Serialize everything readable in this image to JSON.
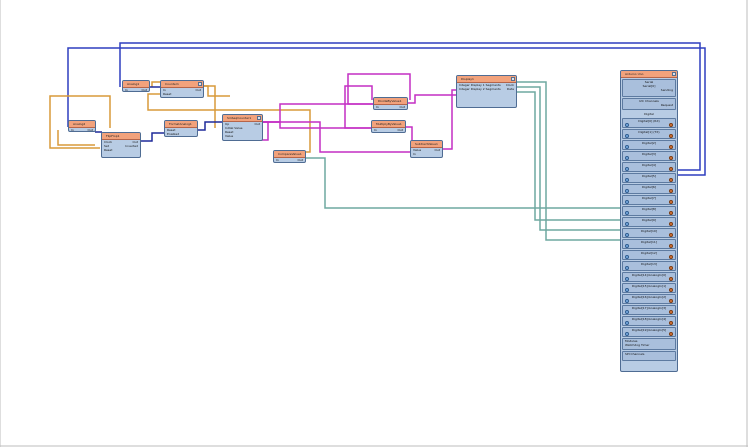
{
  "colors": {
    "node_fill": "#b8cce4",
    "node_header": "#f2a27c",
    "wire_blue": "#2f3fbf",
    "wire_orange": "#d89a3a",
    "wire_magenta": "#c42fc4",
    "wire_teal": "#6fa8a0",
    "wire_navy": "#1f2a9a"
  },
  "nodes": {
    "analog_top": {
      "title": "Analog1",
      "pins": [
        "In",
        "Out"
      ]
    },
    "counter": {
      "title": "Counter1",
      "pins": [
        "In",
        "Reset",
        "Out"
      ]
    },
    "analog_left": {
      "title": "Analog2",
      "pins": [
        "In",
        "Out"
      ]
    },
    "flipflop": {
      "title": "FlipFlop1",
      "pins": [
        "Clock",
        "Set",
        "Reset",
        "Out",
        "Inverted"
      ]
    },
    "smooth": {
      "title": "FormatAnalog1",
      "pins": [
        "Reset",
        "Enabled"
      ]
    },
    "sequence": {
      "title": "SinSeqCounter1",
      "pins": [
        "Up",
        "Initial Value",
        "Reset",
        "Value",
        "Out"
      ]
    },
    "compare": {
      "title": "CompareValue1",
      "pins": [
        "In",
        "Out"
      ]
    },
    "divide": {
      "title": "DivideByValue1",
      "pins": [
        "In",
        "Out"
      ]
    },
    "multiply": {
      "title": "MultiplyByValue1",
      "pins": [
        "In",
        "Out"
      ]
    },
    "subtract": {
      "title": "SubtractValue1",
      "pins": [
        "Value",
        "In",
        "Out"
      ]
    },
    "display": {
      "title": "Display1",
      "pins": [
        "Integer Display 1 Segments",
        "Integer Display 2 Segments",
        "Clock",
        "Data"
      ]
    }
  },
  "board": {
    "title": "Arduino Uno",
    "top": [
      "Serial",
      "Serial[0]",
      "Sending",
      "Out"
    ],
    "i2c": [
      "I2C Channels",
      "Out",
      "Request"
    ],
    "digital_label": "Digital",
    "pins": [
      "Digital[0] (RX)",
      "Digital[1] (TX)",
      "Digital[2]",
      "Digital[3]",
      "Digital[4]",
      "Digital[5]",
      "Digital[6]",
      "Digital[7]",
      "Digital[8]",
      "Digital[9]",
      "Digital[10]",
      "Digital[11]",
      "Digital[12]",
      "Digital[13]",
      "Digital[14]/AnalogIn[0]",
      "Digital[15]/AnalogIn[1]",
      "Digital[16]/AnalogIn[2]",
      "Digital[17]/AnalogIn[3]",
      "Digital[18]/AnalogIn[4]",
      "Digital[19]/AnalogIn[5]"
    ],
    "bottom": [
      "Modules",
      "Watchdog Timer",
      "Clock",
      "SPI Channels",
      "Digital"
    ]
  }
}
